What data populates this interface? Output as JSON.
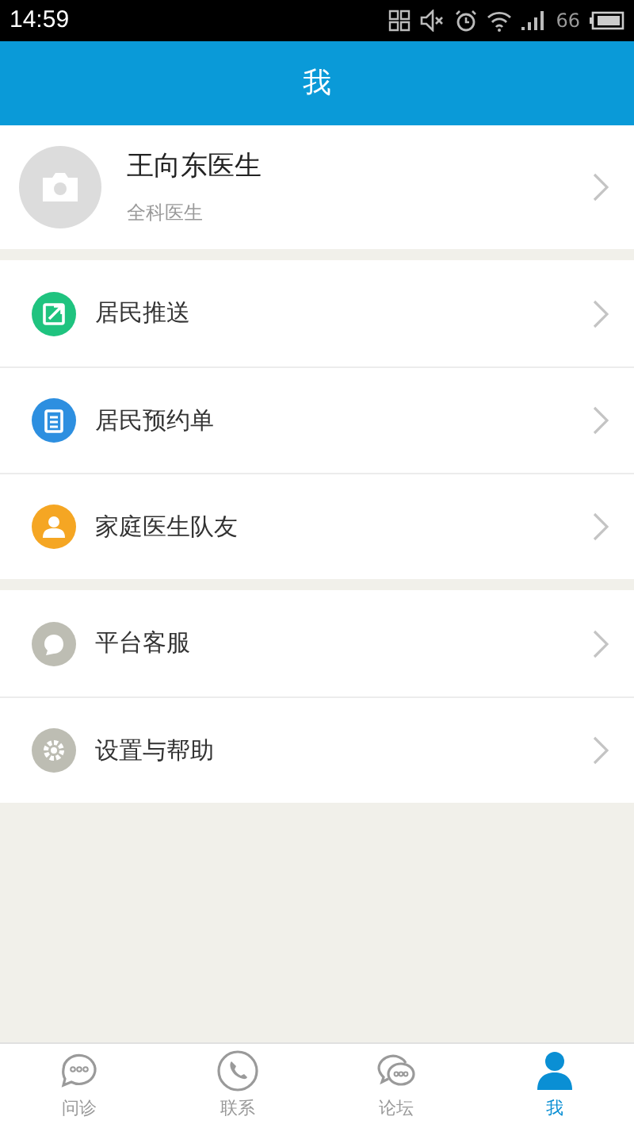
{
  "status_bar": {
    "time": "14:59",
    "battery": "66"
  },
  "header": {
    "title": "我"
  },
  "profile": {
    "name": "王向东医生",
    "role": "全科医生"
  },
  "menu_groups": [
    {
      "items": [
        {
          "kind": "push",
          "label": "居民推送",
          "color": "#1fc37f"
        },
        {
          "kind": "appointment",
          "label": "居民预约单",
          "color": "#2d8fe0"
        },
        {
          "kind": "team",
          "label": "家庭医生队友",
          "color": "#f5a623"
        }
      ]
    },
    {
      "items": [
        {
          "kind": "service",
          "label": "平台客服",
          "color": "#bdbdb3"
        },
        {
          "kind": "settings",
          "label": "设置与帮助",
          "color": "#bdbdb3"
        }
      ]
    }
  ],
  "tabs": [
    {
      "kind": "chat",
      "label": "问诊",
      "selected": false
    },
    {
      "kind": "phone",
      "label": "联系",
      "selected": false
    },
    {
      "kind": "forum",
      "label": "论坛",
      "selected": false
    },
    {
      "kind": "me",
      "label": "我",
      "selected": true
    }
  ]
}
